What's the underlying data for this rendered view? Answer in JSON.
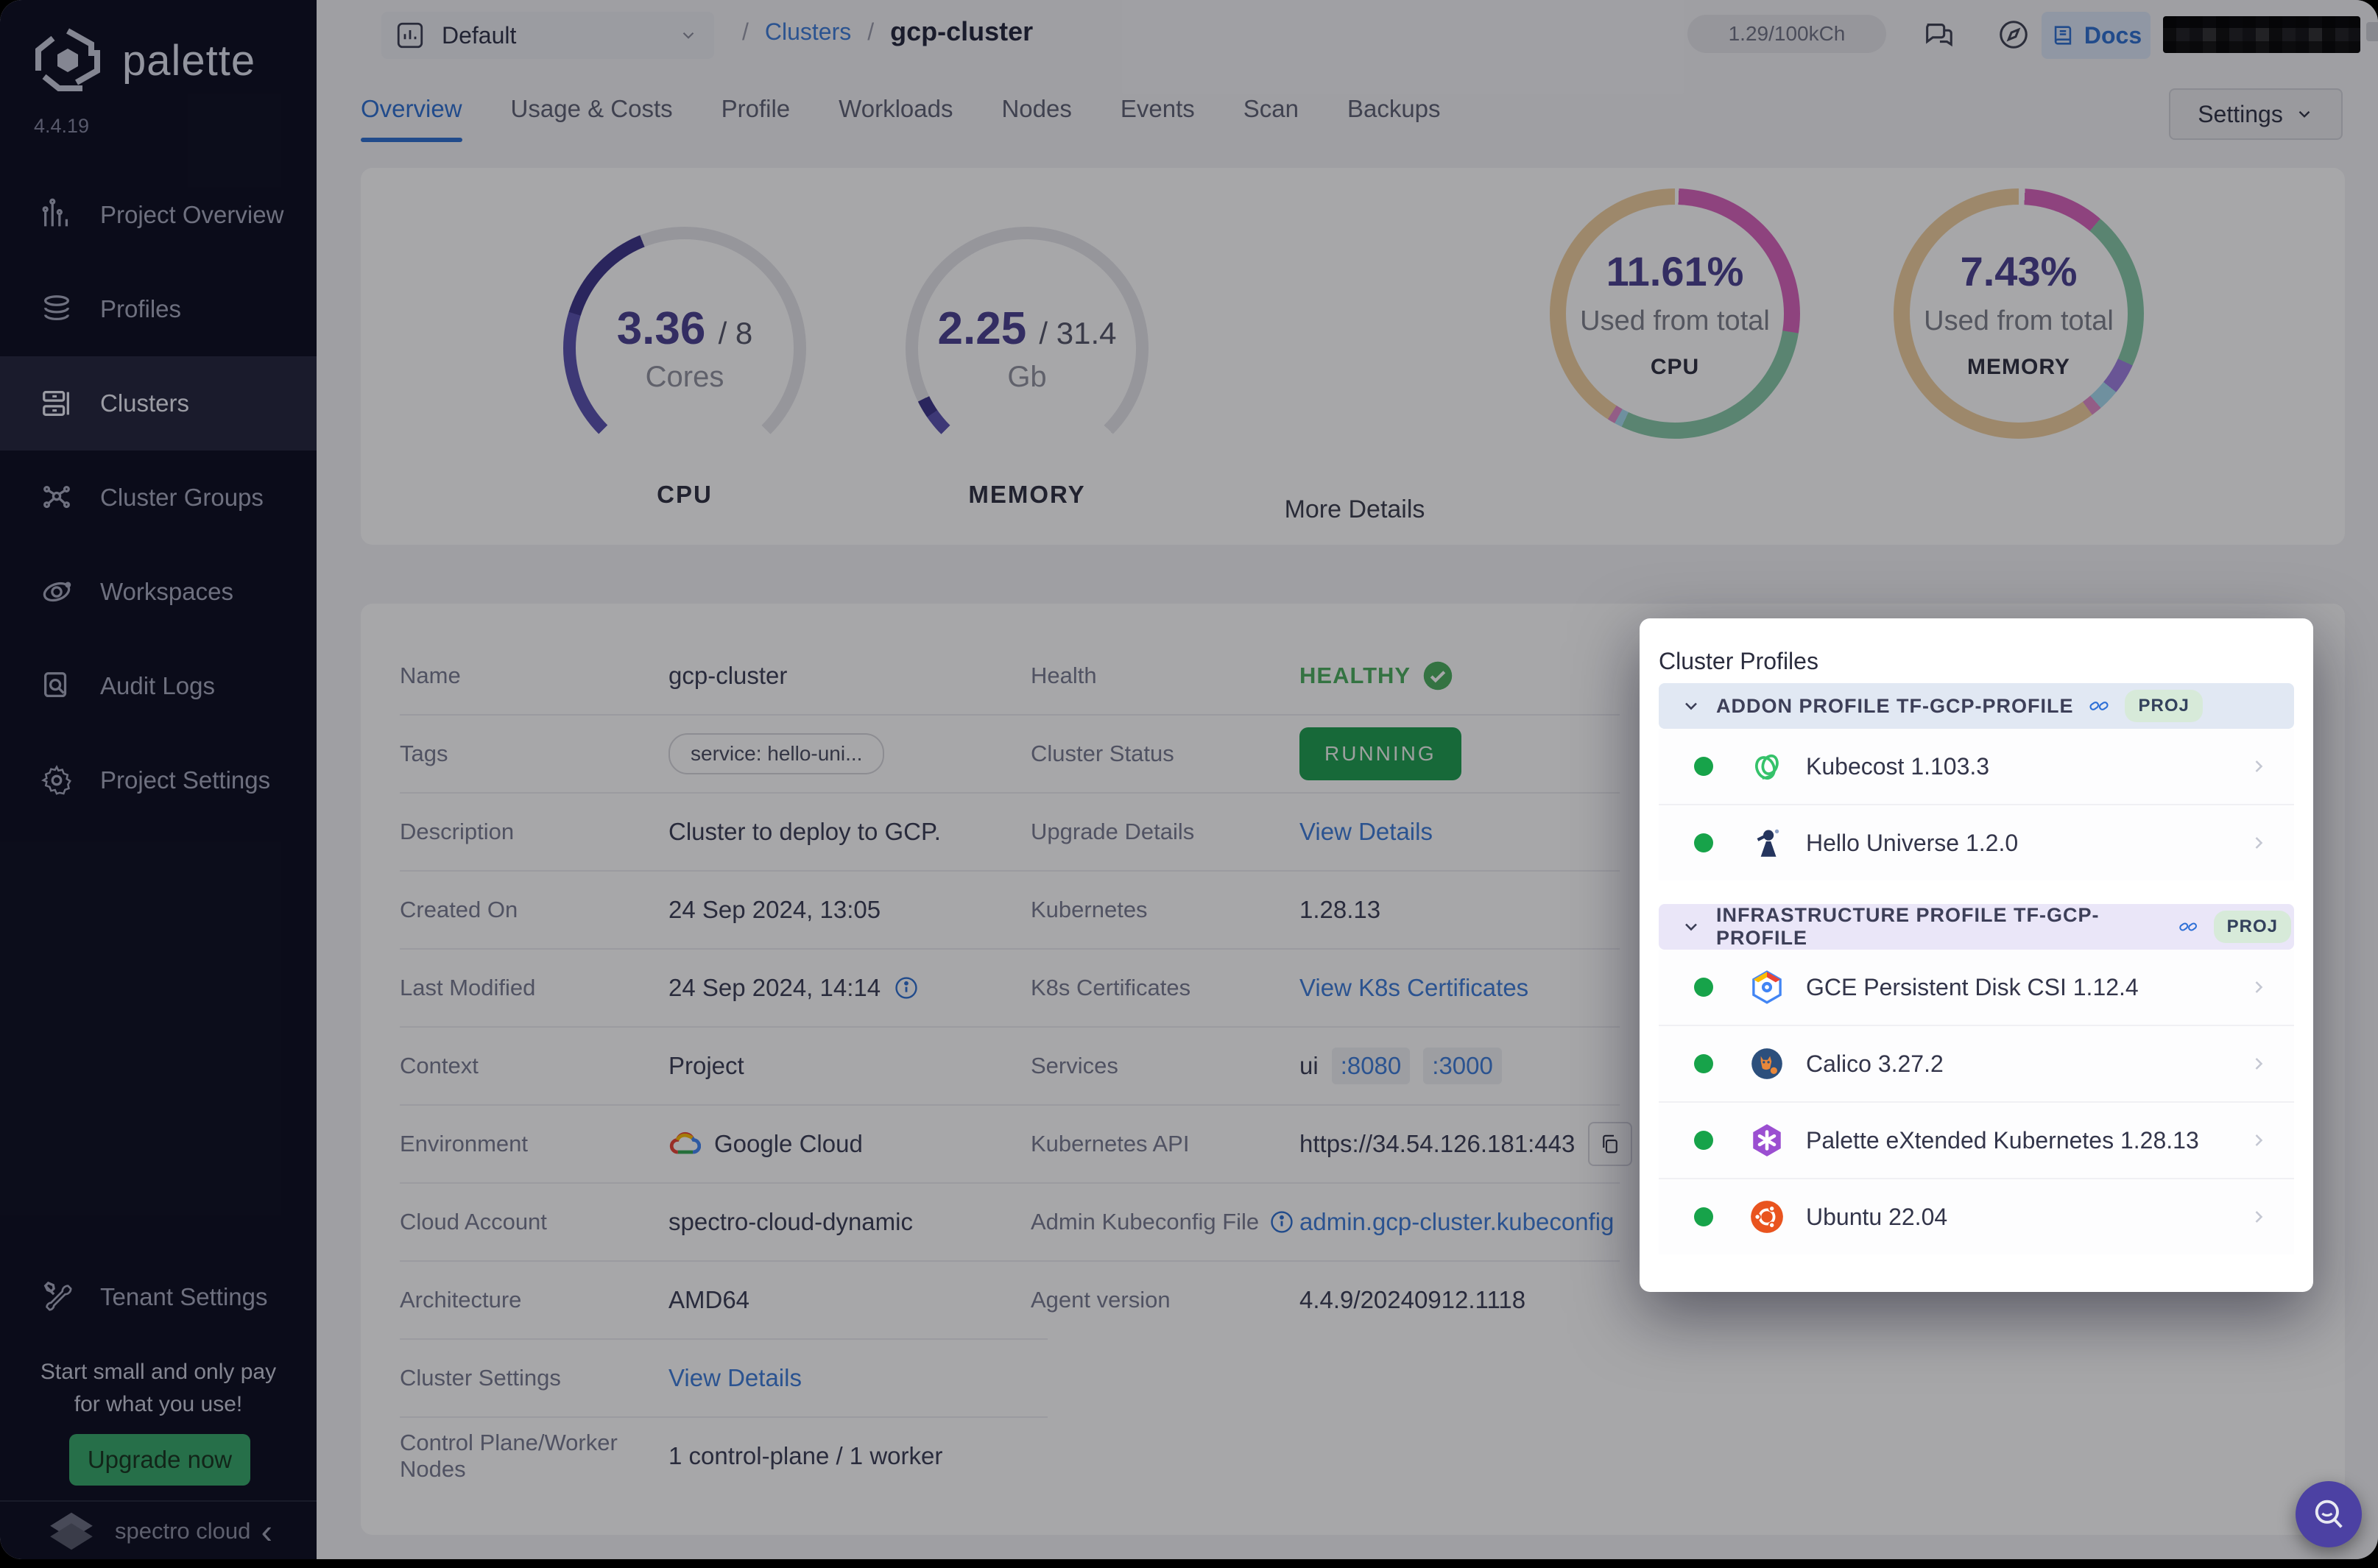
{
  "app": {
    "brand": "palette",
    "version": "4.4.19",
    "footer_brand": "spectro cloud"
  },
  "sidebar": {
    "items": [
      {
        "label": "Project Overview",
        "icon": "chart-bars"
      },
      {
        "label": "Profiles",
        "icon": "layers"
      },
      {
        "label": "Clusters",
        "icon": "servers"
      },
      {
        "label": "Cluster Groups",
        "icon": "network"
      },
      {
        "label": "Workspaces",
        "icon": "orbit"
      },
      {
        "label": "Audit Logs",
        "icon": "doc-search"
      },
      {
        "label": "Project Settings",
        "icon": "gear"
      }
    ],
    "active_index": 2,
    "tenant_label": "Tenant Settings",
    "promo_line1": "Start small and only pay",
    "promo_line2": "for what you use!",
    "upgrade_label": "Upgrade now"
  },
  "topbar": {
    "project_selector": "Default",
    "breadcrumb": {
      "sep": "/",
      "parent": "Clusters",
      "current": "gcp-cluster"
    },
    "usage_pill": "1.29/100kCh",
    "docs_label": "Docs"
  },
  "tabs": {
    "items": [
      "Overview",
      "Usage & Costs",
      "Profile",
      "Workloads",
      "Nodes",
      "Events",
      "Scan",
      "Backups"
    ],
    "active": "Overview",
    "settings_label": "Settings"
  },
  "charts": {
    "more_details_label": "More Details",
    "gauges": [
      {
        "caption": "CPU",
        "value": "3.36",
        "max": "8",
        "unit": "Cores",
        "pct": 42,
        "fill_colors": [
          "#5a52b0",
          "#3c3488"
        ],
        "track": "#e4e4ea"
      },
      {
        "caption": "MEMORY",
        "value": "2.25",
        "max": "31.4",
        "unit": "Gb",
        "pct": 7,
        "fill_colors": [
          "#5a52b0",
          "#3c3488"
        ],
        "track": "#e4e4ea"
      }
    ],
    "donuts": [
      {
        "caption": "CPU",
        "value": "11.61%",
        "sub": "Used from total",
        "segments": [
          [
            "#ffffff",
            0.5
          ],
          [
            "#d863bc",
            27
          ],
          [
            "#87c9a8",
            29.5
          ],
          [
            "#a8dcf0",
            1
          ],
          [
            "#e08cc8",
            1
          ],
          [
            "#f0cf9e",
            41
          ]
        ]
      },
      {
        "caption": "MEMORY",
        "value": "7.43%",
        "sub": "Used from total",
        "segments": [
          [
            "#ffffff",
            0.8
          ],
          [
            "#d863bc",
            10.5
          ],
          [
            "#87c9a8",
            20.5
          ],
          [
            "#9f7fe0",
            4
          ],
          [
            "#a8dcf0",
            2.8
          ],
          [
            "#e08cc8",
            1.4
          ],
          [
            "#f0cf9e",
            60
          ]
        ]
      }
    ]
  },
  "details": {
    "left_rows": [
      {
        "label": "Name",
        "type": "text",
        "value": "gcp-cluster"
      },
      {
        "label": "Tags",
        "type": "tag",
        "value": "service: hello-uni..."
      },
      {
        "label": "Description",
        "type": "text",
        "value": "Cluster to deploy to GCP."
      },
      {
        "label": "Created On",
        "type": "text",
        "value": "24 Sep 2024, 13:05"
      },
      {
        "label": "Last Modified",
        "type": "text-info",
        "value": "24 Sep 2024, 14:14"
      },
      {
        "label": "Context",
        "type": "text",
        "value": "Project"
      },
      {
        "label": "Environment",
        "type": "gcloud",
        "value": "Google Cloud"
      },
      {
        "label": "Cloud Account",
        "type": "text",
        "value": "spectro-cloud-dynamic"
      },
      {
        "label": "Architecture",
        "type": "text",
        "value": "AMD64"
      },
      {
        "label": "Cluster Settings",
        "type": "link",
        "value": "View Details"
      },
      {
        "label": "Control Plane/Worker Nodes",
        "type": "text",
        "value": "1 control-plane / 1 worker"
      }
    ],
    "right_rows": [
      {
        "label": "Health",
        "type": "health",
        "value": "HEALTHY"
      },
      {
        "label": "Cluster Status",
        "type": "badge",
        "value": "RUNNING"
      },
      {
        "label": "Upgrade Details",
        "type": "link",
        "value": "View Details"
      },
      {
        "label": "Kubernetes",
        "type": "text",
        "value": "1.28.13"
      },
      {
        "label": "K8s Certificates",
        "type": "link",
        "value": "View K8s Certificates"
      },
      {
        "label": "Services",
        "type": "services",
        "value": "ui",
        "links": [
          ":8080",
          ":3000"
        ]
      },
      {
        "label": "Kubernetes API",
        "type": "api",
        "value": "https://34.54.126.181:443"
      },
      {
        "label": "Admin Kubeconfig File",
        "type": "kubeconfig",
        "value": "admin.gcp-cluster.kubeconfig"
      },
      {
        "label": "Agent version",
        "type": "text",
        "value": "4.4.9/20240912.1118"
      }
    ]
  },
  "cluster_profiles": {
    "title": "Cluster Profiles",
    "sections": [
      {
        "header": "ADDON PROFILE TF-GCP-PROFILE",
        "badge": "PROJ",
        "header_bg": "#e1e8f3",
        "items": [
          {
            "name": "Kubecost 1.103.3",
            "icon": "kubecost"
          },
          {
            "name": "Hello Universe 1.2.0",
            "icon": "hello-universe"
          }
        ]
      },
      {
        "header": "INFRASTRUCTURE PROFILE TF-GCP-PROFILE",
        "badge": "PROJ",
        "header_bg": "#eae6f8",
        "items": [
          {
            "name": "GCE Persistent Disk CSI 1.12.4",
            "icon": "gce-pd"
          },
          {
            "name": "Calico 3.27.2",
            "icon": "calico"
          },
          {
            "name": "Palette eXtended Kubernetes 1.28.13",
            "icon": "pxk"
          },
          {
            "name": "Ubuntu 22.04",
            "icon": "ubuntu"
          }
        ]
      }
    ]
  }
}
